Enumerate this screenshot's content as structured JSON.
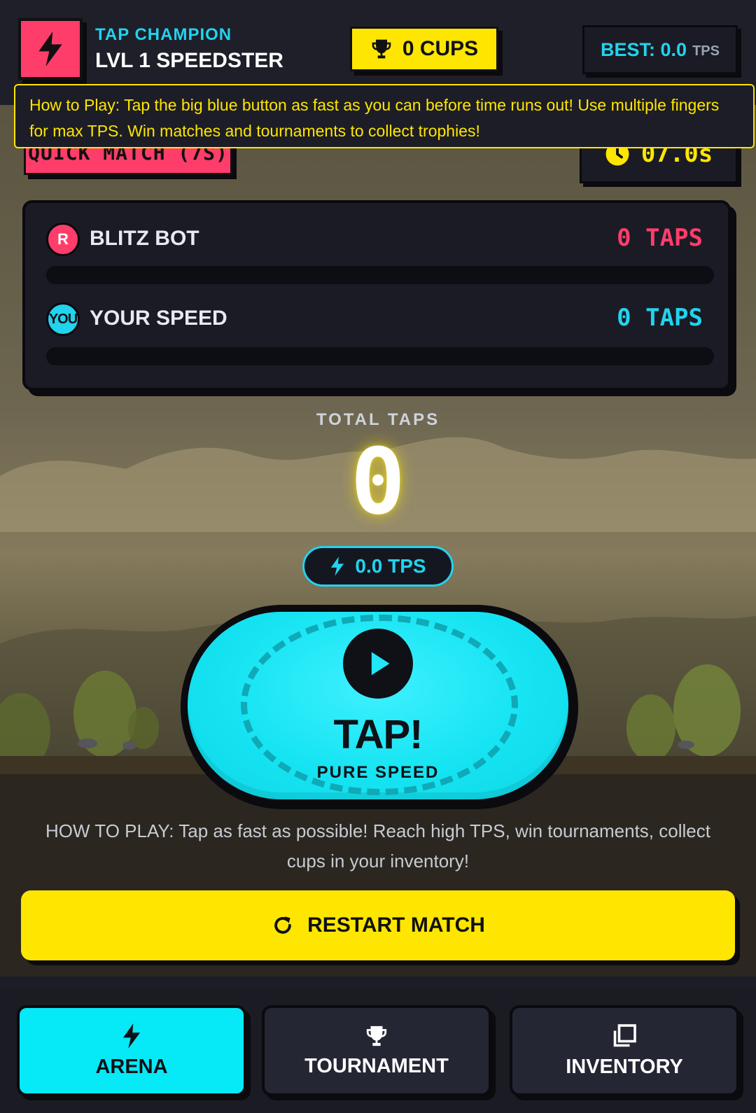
{
  "header": {
    "subtitle": "TAP CHAMPION",
    "title": "LVL 1 SPEEDSTER",
    "logo_icon": "lightning-icon",
    "cups": "0 CUPS",
    "best_label": "BEST: 0.0",
    "best_unit": "TPS"
  },
  "tooltip": {
    "text": "How to Play: Tap the big blue button as fast as you can before time runs out! Use multiple fingers for max TPS. Win matches and tournaments to collect trophies!"
  },
  "mode": {
    "label": "QUICK MATCH (7S)",
    "timer": "07.0s"
  },
  "race": {
    "bot": {
      "avatar": "R",
      "name": "BLITZ BOT",
      "taps": "0  TAPS",
      "progress": 0,
      "color": "#ff3d6b"
    },
    "player": {
      "avatar": "YOU",
      "name": "YOUR SPEED",
      "taps": "0  TAPS",
      "progress": 0,
      "color": "#22d3ee"
    }
  },
  "counter": {
    "label": "TOTAL TAPS",
    "value": "0",
    "tps": "0.0  TPS"
  },
  "tap_button": {
    "label": "TAP!",
    "sub": "PURE SPEED"
  },
  "howto": "HOW TO PLAY: Tap as fast as possible! Reach high TPS, win tournaments, collect cups in your inventory!",
  "restart_label": "RESTART MATCH",
  "nav": {
    "items": [
      {
        "label": "ARENA",
        "icon": "lightning-icon",
        "active": true
      },
      {
        "label": "TOURNAMENT",
        "icon": "trophy-icon",
        "active": false
      },
      {
        "label": "INVENTORY",
        "icon": "inventory-icon",
        "active": false
      }
    ]
  },
  "colors": {
    "accent_cyan": "#22d3ee",
    "accent_pink": "#ff3d6b",
    "accent_yellow": "#ffe600",
    "panel": "#1a1b24"
  }
}
